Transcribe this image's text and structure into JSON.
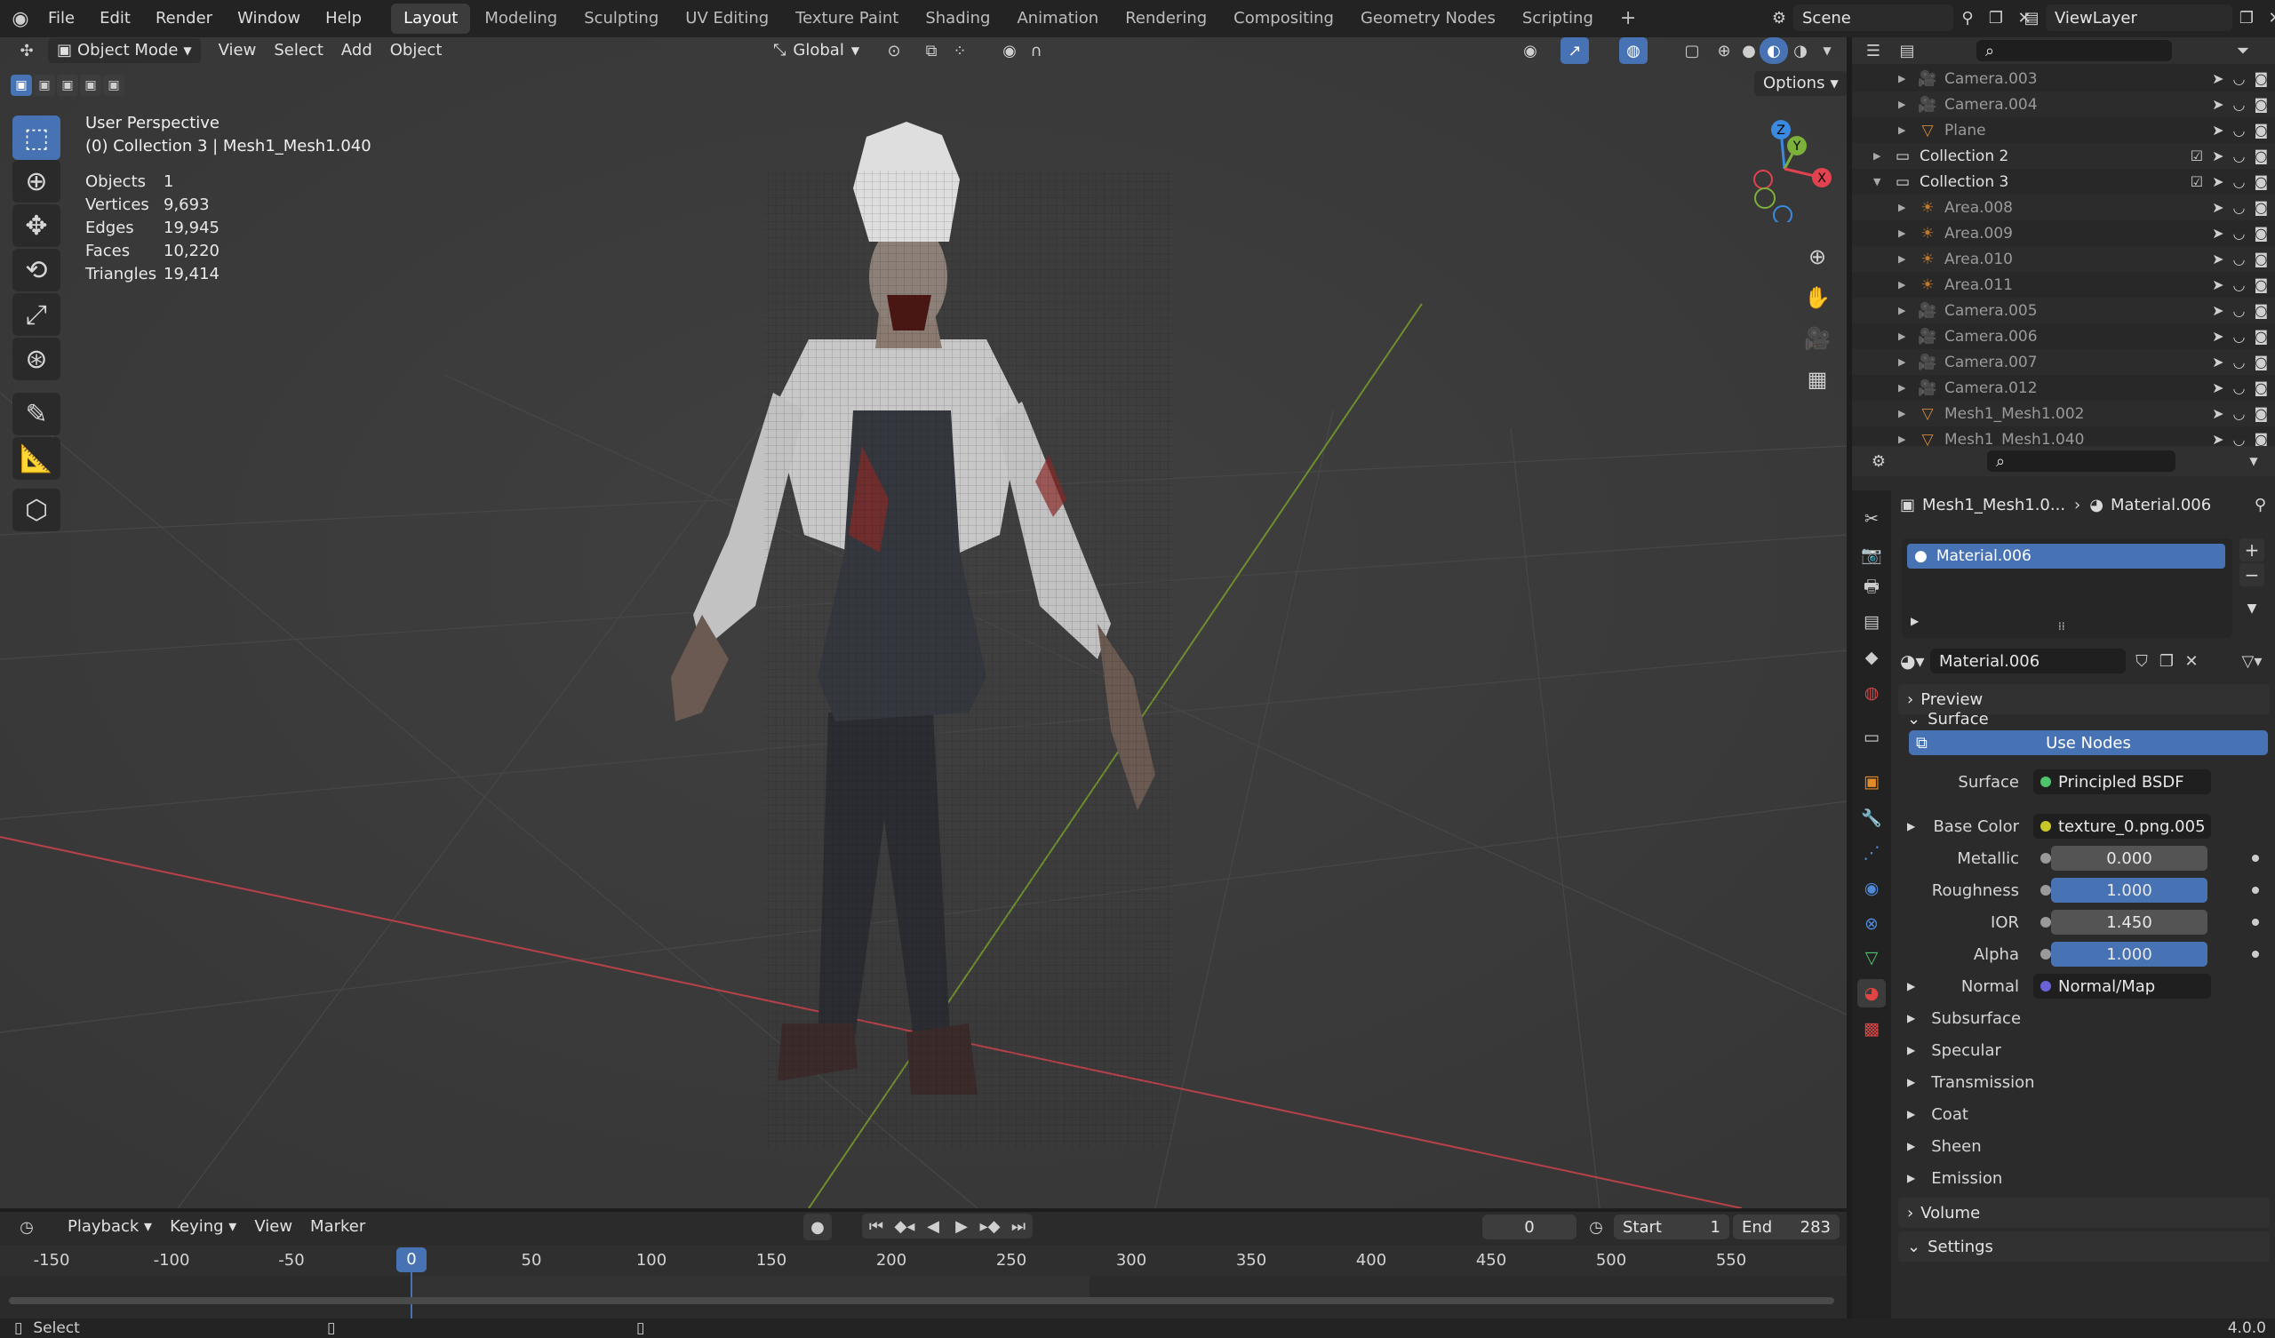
{
  "topbar": {
    "menus": [
      "File",
      "Edit",
      "Render",
      "Window",
      "Help"
    ],
    "workspaces": [
      "Layout",
      "Modeling",
      "Sculpting",
      "UV Editing",
      "Texture Paint",
      "Shading",
      "Animation",
      "Rendering",
      "Compositing",
      "Geometry Nodes",
      "Scripting"
    ],
    "active_workspace": "Layout",
    "add_tab": "+",
    "scene": "Scene",
    "view_layer": "ViewLayer"
  },
  "viewport": {
    "mode": "Object Mode",
    "menus": [
      "View",
      "Select",
      "Add",
      "Object"
    ],
    "orientation": "Global",
    "options": "Options",
    "overlay_title": "User Perspective",
    "overlay_sub": "(0) Collection 3 | Mesh1_Mesh1.040",
    "stats": [
      {
        "k": "Objects",
        "v": "1"
      },
      {
        "k": "Vertices",
        "v": "9,693"
      },
      {
        "k": "Edges",
        "v": "19,945"
      },
      {
        "k": "Faces",
        "v": "10,220"
      },
      {
        "k": "Triangles",
        "v": "19,414"
      }
    ],
    "gizmo": {
      "z": "Z",
      "y": "Y",
      "x": "X"
    }
  },
  "outliner": {
    "rows": [
      {
        "name": "Camera.003",
        "type": "camera",
        "coll": false
      },
      {
        "name": "Camera.004",
        "type": "camera",
        "coll": false
      },
      {
        "name": "Plane",
        "type": "mesh",
        "coll": false
      },
      {
        "name": "Collection 2",
        "type": "collection",
        "coll": true
      },
      {
        "name": "Collection 3",
        "type": "collection",
        "coll": true
      },
      {
        "name": "Area.008",
        "type": "light",
        "coll": false
      },
      {
        "name": "Area.009",
        "type": "light",
        "coll": false
      },
      {
        "name": "Area.010",
        "type": "light",
        "coll": false
      },
      {
        "name": "Area.011",
        "type": "light",
        "coll": false
      },
      {
        "name": "Camera.005",
        "type": "camera",
        "coll": false
      },
      {
        "name": "Camera.006",
        "type": "camera",
        "coll": false
      },
      {
        "name": "Camera.007",
        "type": "camera",
        "coll": false
      },
      {
        "name": "Camera.012",
        "type": "camera",
        "coll": false
      },
      {
        "name": "Mesh1_Mesh1.002",
        "type": "mesh",
        "coll": false
      },
      {
        "name": "Mesh1_Mesh1.040",
        "type": "mesh",
        "coll": false
      }
    ]
  },
  "properties": {
    "breadcrumb_object": "Mesh1_Mesh1.0...",
    "breadcrumb_material": "Material.006",
    "slot": "Material.006",
    "material_name": "Material.006",
    "sections": {
      "preview": "Preview",
      "surface": "Surface",
      "volume": "Volume",
      "settings": "Settings"
    },
    "use_nodes": "Use Nodes",
    "surface_label": "Surface",
    "surface_value": "Principled BSDF",
    "base_color_label": "Base Color",
    "base_color_value": "texture_0.png.005",
    "metallic_label": "Metallic",
    "metallic_value": "0.000",
    "roughness_label": "Roughness",
    "roughness_value": "1.000",
    "ior_label": "IOR",
    "ior_value": "1.450",
    "alpha_label": "Alpha",
    "alpha_value": "1.000",
    "normal_label": "Normal",
    "normal_value": "Normal/Map",
    "subpanels": [
      "Subsurface",
      "Specular",
      "Transmission",
      "Coat",
      "Sheen",
      "Emission"
    ]
  },
  "timeline": {
    "menus": [
      "Playback",
      "Keying",
      "View",
      "Marker"
    ],
    "current_frame": "0",
    "start_label": "Start",
    "start_value": "1",
    "end_label": "End",
    "end_value": "283",
    "ticks": [
      "-150",
      "-100",
      "-50",
      "0",
      "50",
      "100",
      "150",
      "200",
      "250",
      "300",
      "350",
      "400",
      "450",
      "500",
      "550"
    ]
  },
  "status": {
    "left": "Select",
    "version": "4.0.0"
  },
  "colors": {
    "accent": "#4772b3",
    "axis_x": "#e0434f",
    "axis_y": "#7bb03a",
    "axis_z": "#3a8ae0"
  }
}
